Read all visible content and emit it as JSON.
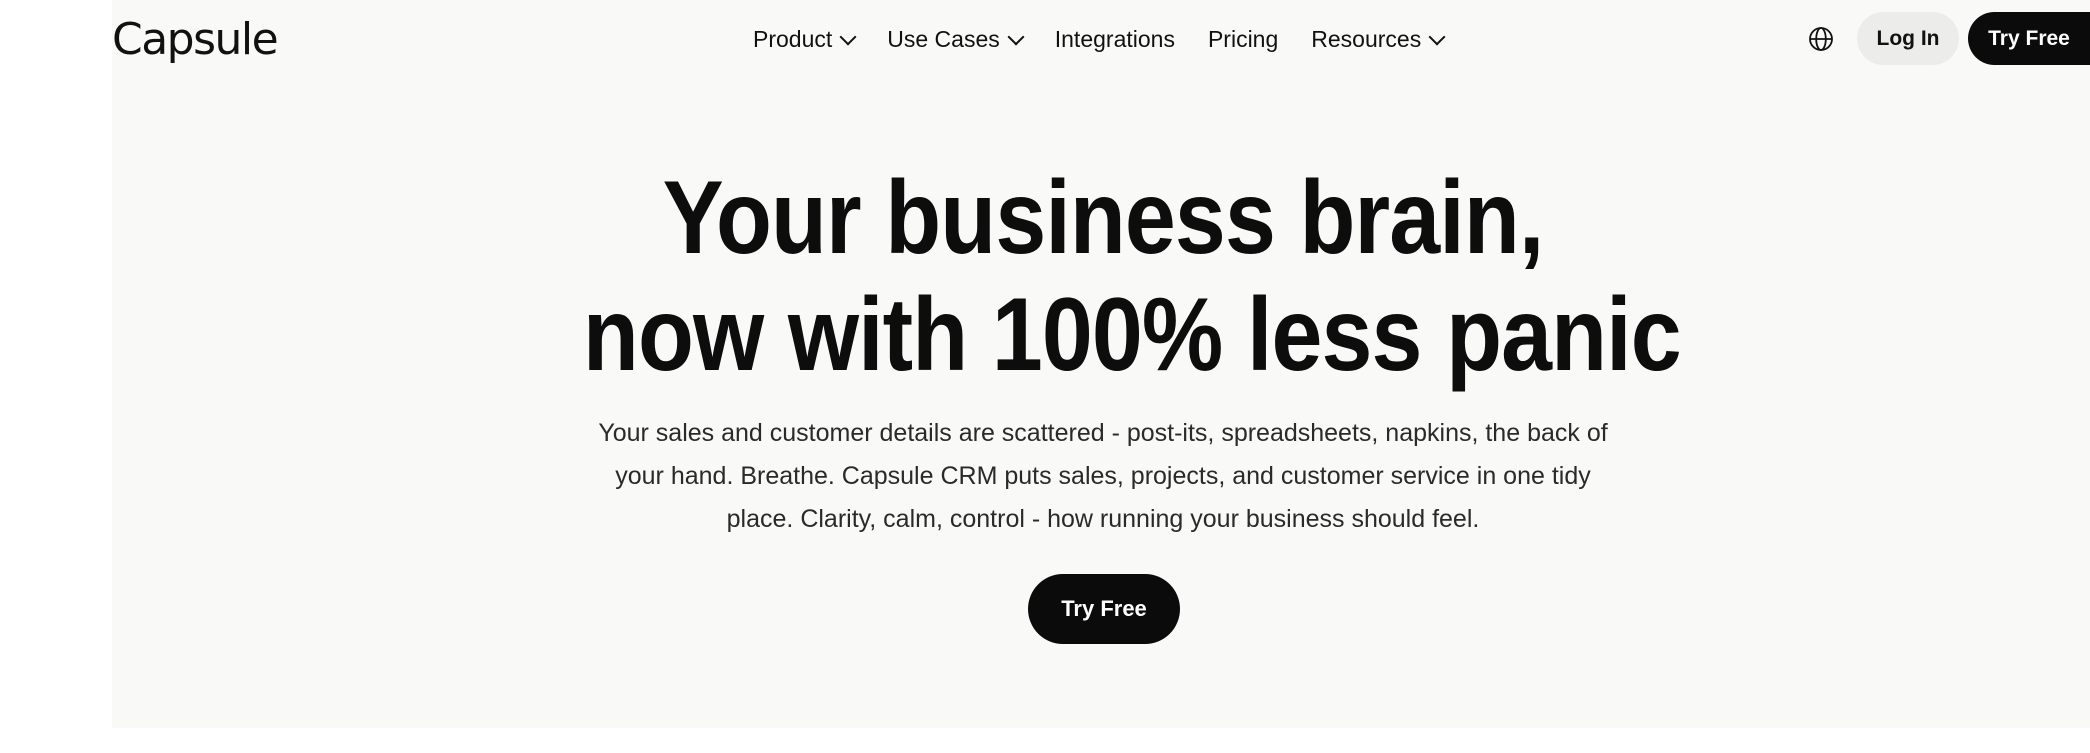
{
  "brand": {
    "logo_text": "Capsule"
  },
  "nav": {
    "items": [
      {
        "label": "Product",
        "has_dropdown": true
      },
      {
        "label": "Use Cases",
        "has_dropdown": true
      },
      {
        "label": "Integrations",
        "has_dropdown": false
      },
      {
        "label": "Pricing",
        "has_dropdown": false
      },
      {
        "label": "Resources",
        "has_dropdown": true
      }
    ],
    "language_icon": "globe-icon",
    "login_label": "Log In",
    "try_free_label": "Try Free"
  },
  "hero": {
    "headline_line1": "Your business brain,",
    "headline_line2": "now with 100% less panic",
    "subtext": "Your sales and customer details are scattered - post-its, spreadsheets, napkins, the back of your hand. Breathe. Capsule CRM puts sales, projects, and customer service in one tidy place. Clarity, calm, control - how running your business should feel.",
    "cta_label": "Try Free"
  },
  "colors": {
    "background": "#f9f9f7",
    "primary_button": "#0b0b0b",
    "secondary_button": "#ececeb",
    "text": "#0d0d0d"
  }
}
